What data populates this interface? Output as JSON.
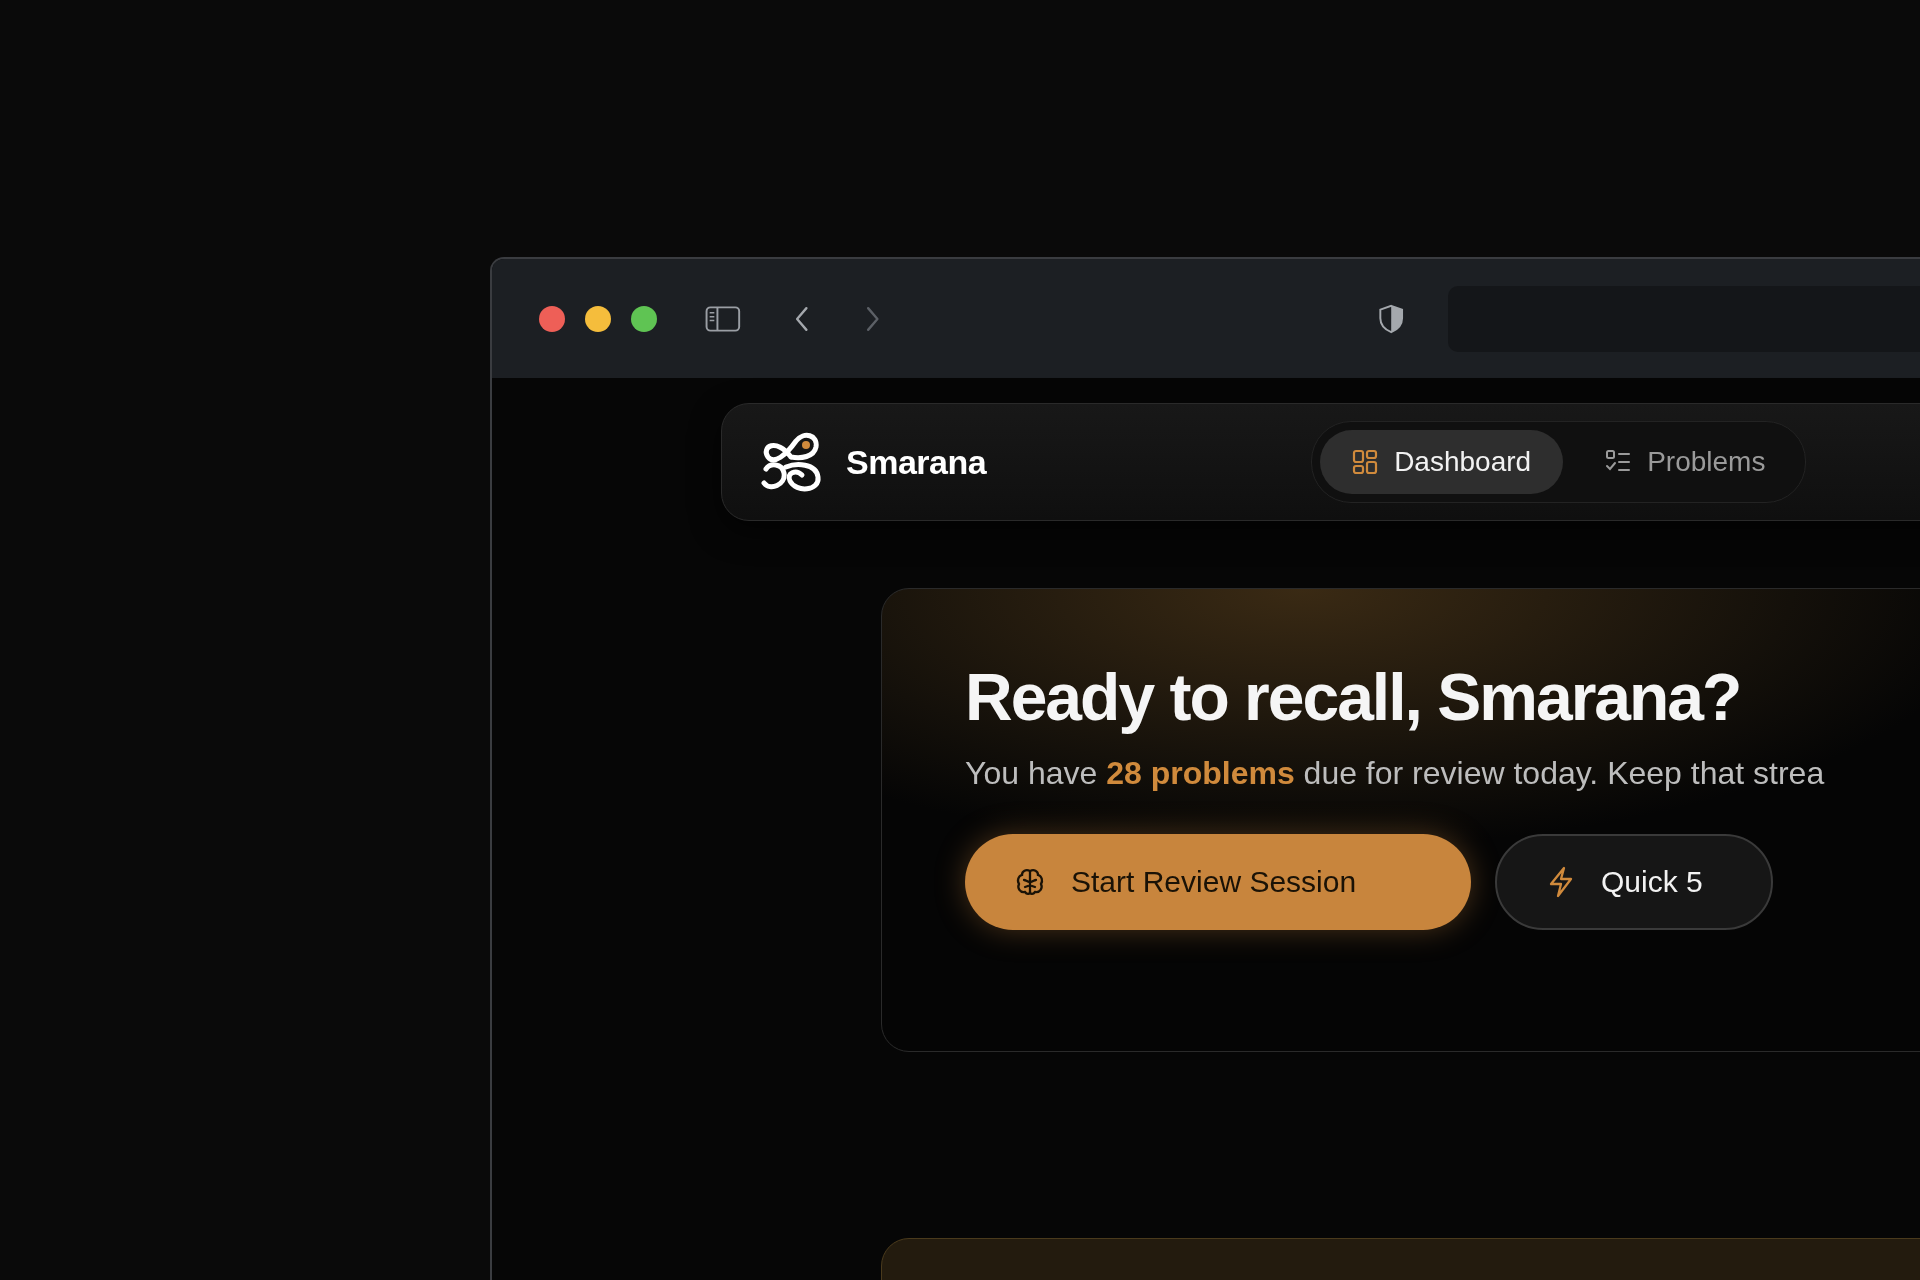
{
  "app": {
    "name": "Smarana"
  },
  "nav_tabs": [
    {
      "label": "Dashboard",
      "selected": true
    },
    {
      "label": "Problems",
      "selected": false
    }
  ],
  "hero": {
    "title": "Ready to recall, Smarana?",
    "subtitle": "You have **28 problems** due for review today. Keep that strea",
    "buttons": [
      {
        "label": "Start Review Session",
        "kind": "primary"
      },
      {
        "label": "Quick 5",
        "kind": "secondary"
      }
    ]
  }
}
